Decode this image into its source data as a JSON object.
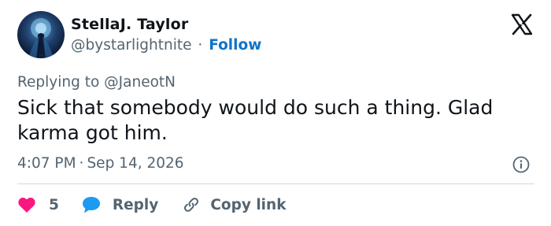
{
  "author": {
    "name": "StellaJ. Taylor",
    "handle": "@bystarlightnite",
    "separator": "·",
    "follow_label": "Follow"
  },
  "reply_to": "Replying to @JaneotN",
  "tweet": {
    "text": "Sick that somebody would do such a thing. Glad karma got him.",
    "time": "4:07 PM",
    "separator": "·",
    "date": "Sep 14, 2026"
  },
  "actions": {
    "like_count": "5",
    "reply_label": "Reply",
    "copy_label": "Copy link"
  },
  "icons": {
    "platform": "x-logo-icon",
    "info": "info-icon",
    "like": "heart-icon",
    "reply": "speech-bubble-icon",
    "copy": "link-icon"
  },
  "colors": {
    "like": "#f91880",
    "reply": "#1d9bf0",
    "follow": "#0f74c9",
    "secondary_text": "#536471"
  }
}
